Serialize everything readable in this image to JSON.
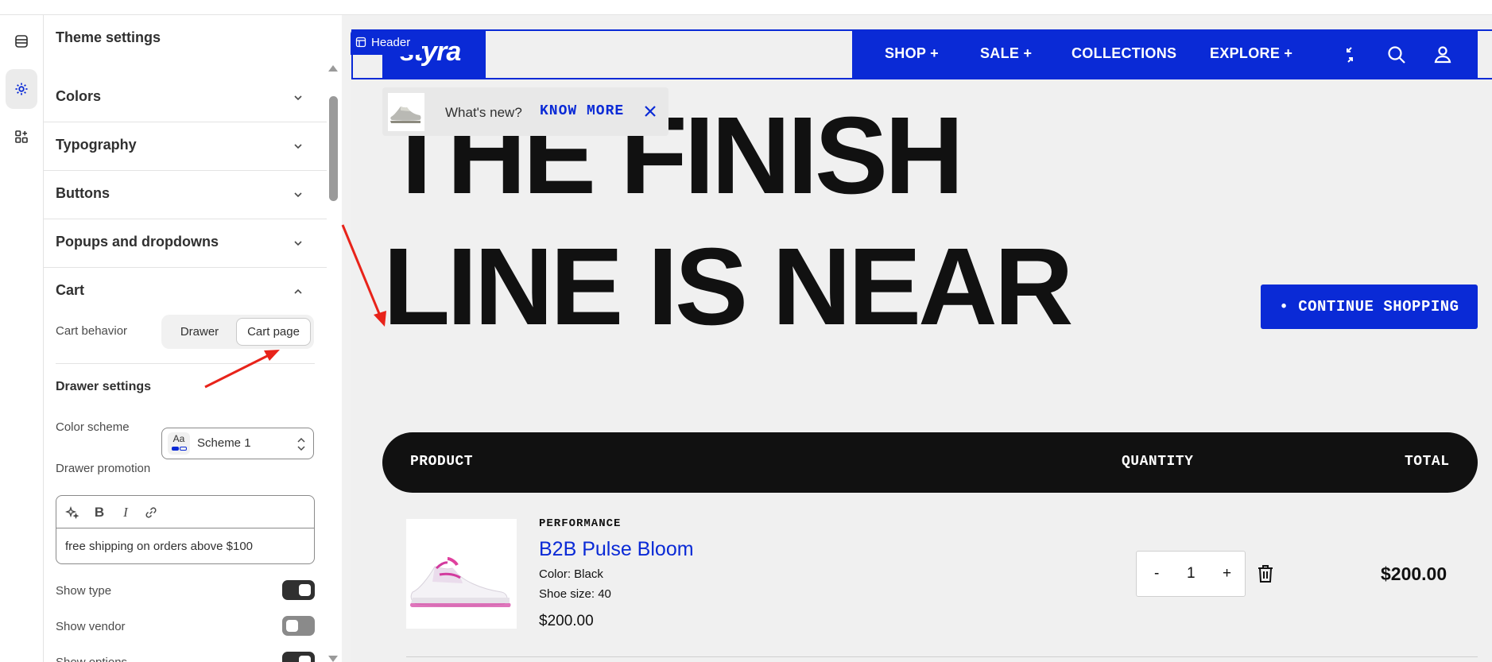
{
  "panel": {
    "title": "Theme settings",
    "sections": [
      {
        "label": "Colors"
      },
      {
        "label": "Typography"
      },
      {
        "label": "Buttons"
      },
      {
        "label": "Popups and dropdowns"
      },
      {
        "label": "Cart"
      }
    ],
    "cart": {
      "behavior_label": "Cart behavior",
      "behavior_options": [
        "Drawer",
        "Cart page"
      ],
      "behavior_selected": "Cart page",
      "drawer_heading": "Drawer settings",
      "color_scheme_label": "Color scheme",
      "color_scheme_value": "Scheme 1",
      "color_scheme_swatch": "Aa",
      "promotion_label": "Drawer promotion",
      "promotion_text": "free shipping on orders above $100",
      "toggles": [
        {
          "label": "Show type",
          "on": true
        },
        {
          "label": "Show vendor",
          "on": false
        },
        {
          "label": "Show options",
          "on": true
        }
      ]
    }
  },
  "preview": {
    "header_tag": "Header",
    "logo": "styra",
    "nav": [
      "SHOP +",
      "SALE +",
      "COLLECTIONS",
      "EXPLORE +"
    ],
    "popup": {
      "question": "What's new?",
      "link": "KNOW MORE"
    },
    "hero": [
      "THE FINISH",
      "LINE IS NEAR"
    ],
    "continue": "• CONTINUE SHOPPING",
    "table_headers": {
      "product": "PRODUCT",
      "quantity": "QUANTITY",
      "total": "TOTAL"
    },
    "item": {
      "vendor": "PERFORMANCE",
      "name": "B2B Pulse Bloom",
      "color": "Color: Black",
      "size": "Shoe size: 40",
      "price": "$200.00",
      "qty_minus": "-",
      "qty": "1",
      "qty_plus": "+",
      "total": "$200.00"
    }
  },
  "colors": {
    "accent": "#0a2ad6",
    "annotation": "#e8231a"
  }
}
